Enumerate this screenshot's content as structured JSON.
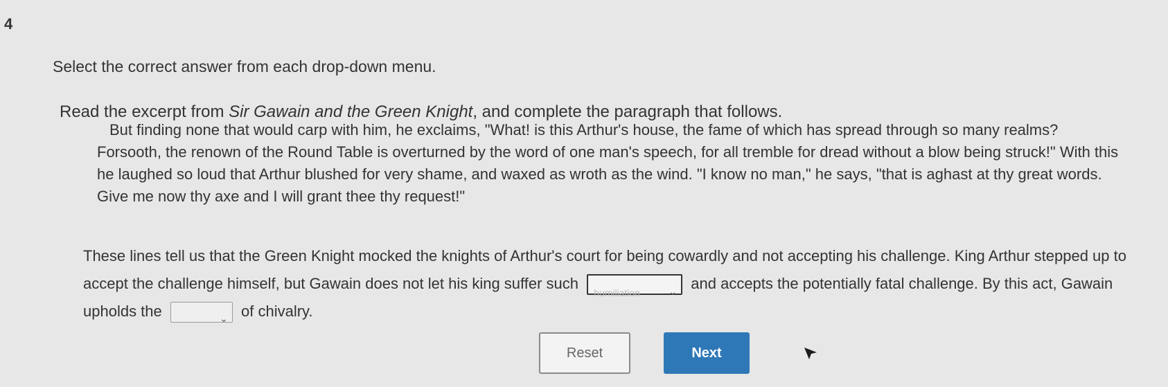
{
  "question_number": "4",
  "instruction": "Select the correct answer from each drop-down menu.",
  "read_prompt": {
    "before": "Read the excerpt from ",
    "title": "Sir Gawain and the Green Knight",
    "after": ", and complete the paragraph that follows."
  },
  "excerpt": "But finding none that would carp with him, he exclaims, \"What! is this Arthur's house, the fame of which has spread through so many realms? Forsooth, the renown of the Round Table is overturned by the word of one man's speech, for all tremble for dread without a blow being struck!\" With this he laughed so loud that Arthur blushed for very shame, and waxed as wroth as the wind. \"I know no man,\" he says, \"that is aghast at thy great words. Give me now thy axe and I will grant thee thy request!\"",
  "paragraph": {
    "part1": "These lines tell us that the Green Knight mocked the knights of Arthur's court for being cowardly and not accepting his challenge. King Arthur stepped up to accept the challenge himself, but Gawain does not let his king suffer such",
    "dropdown1_value": "humiliation",
    "part2": "and accepts the potentially fatal challenge. By this act, Gawain upholds the",
    "dropdown2_value": "",
    "part3": "of chivalry."
  },
  "buttons": {
    "reset": "Reset",
    "next": "Next"
  },
  "icons": {
    "dropdown_chevron": "chevron-down-icon",
    "cursor": "mouse-pointer-icon"
  },
  "colors": {
    "next_button": "#2f78b7",
    "background": "#e6e7e6"
  }
}
